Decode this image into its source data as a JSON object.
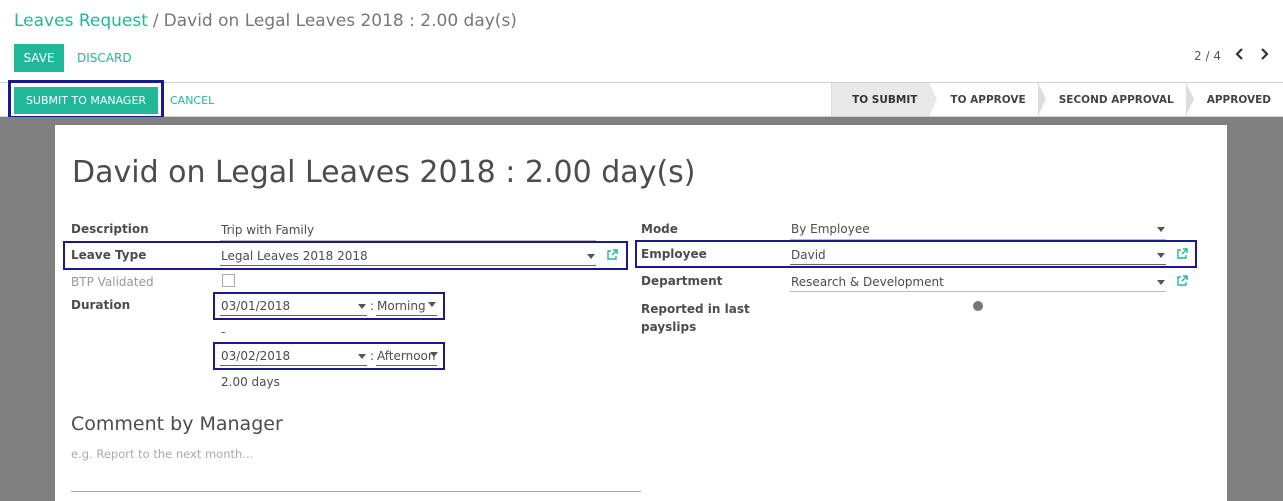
{
  "breadcrumb": {
    "parent": "Leaves Request",
    "separator": "/",
    "current": "David on Legal Leaves 2018 : 2.00 day(s)"
  },
  "toolbar": {
    "save_label": "SAVE",
    "discard_label": "DISCARD"
  },
  "pager": {
    "value": "2 / 4",
    "prev_icon": "chevron-left-icon",
    "next_icon": "chevron-right-icon"
  },
  "statusbar": {
    "submit_label": "SUBMIT TO MANAGER",
    "cancel_label": "CANCEL",
    "stages": [
      "TO SUBMIT",
      "TO APPROVE",
      "SECOND APPROVAL",
      "APPROVED"
    ],
    "current_stage": "TO SUBMIT"
  },
  "form": {
    "title": "David on Legal Leaves 2018 : 2.00 day(s)",
    "description_label": "Description",
    "description_value": "Trip with Family",
    "leave_type_label": "Leave Type",
    "leave_type_value": "Legal Leaves 2018 2018",
    "btp_label": "BTP Validated",
    "duration_label": "Duration",
    "date_from": "03/01/2018",
    "from_period_sep": ":",
    "from_period": "Morning",
    "range_sep": "-",
    "date_to": "03/02/2018",
    "to_period_sep": ":",
    "to_period": "Afternoon",
    "days": "2.00 days",
    "mode_label": "Mode",
    "mode_value": "By Employee",
    "employee_label": "Employee",
    "employee_value": "David",
    "department_label": "Department",
    "department_value": "Research & Development",
    "reported_label": "Reported in last payslips",
    "comment_title": "Comment by Manager",
    "comment_placeholder": "e.g. Report to the next month..."
  },
  "colors": {
    "accent": "#21b799",
    "highlight_box": "#1a1a8c",
    "background": "#808080"
  }
}
